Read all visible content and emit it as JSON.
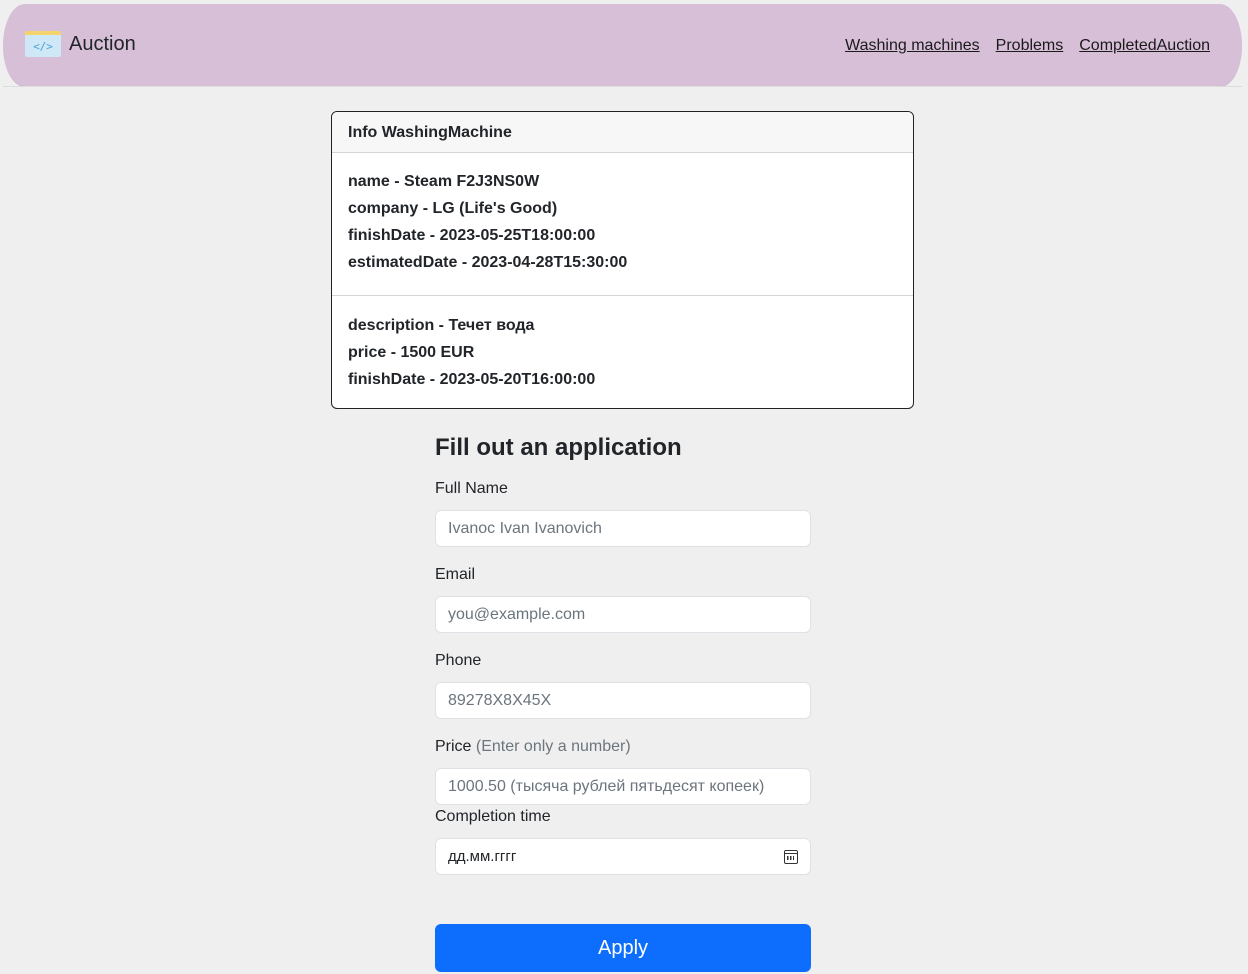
{
  "navbar": {
    "brand_icon_text": "</>",
    "brand_name": "Auction",
    "links": [
      "Washing machines",
      "Problems",
      "CompletedAuction"
    ]
  },
  "info_card": {
    "title": "Info WashingMachine",
    "machine": [
      "name - Steam F2J3NS0W",
      "company - LG (Life's Good)",
      "finishDate - 2023-05-25T18:00:00",
      "estimatedDate - 2023-04-28T15:30:00"
    ],
    "problem": [
      "description - Течет вода",
      "price - 1500 EUR",
      "finishDate - 2023-05-20T16:00:00"
    ]
  },
  "form": {
    "title": "Fill out an application",
    "full_name_label": "Full Name",
    "full_name_placeholder": "Ivanoc Ivan Ivanovich",
    "email_label": "Email",
    "email_placeholder": "you@example.com",
    "phone_label": "Phone",
    "phone_placeholder": "89278X8X45X",
    "price_label": "Price",
    "price_hint": "(Enter only a number)",
    "price_placeholder": "1000.50 (тысяча рублей пятьдесят копеек)",
    "completion_label": "Completion time",
    "completion_value": "дд.мм.гггг",
    "apply_label": "Apply"
  },
  "colors": {
    "navbar": "#d8bfd8",
    "primary": "#0d6efd",
    "background": "#efefef"
  }
}
